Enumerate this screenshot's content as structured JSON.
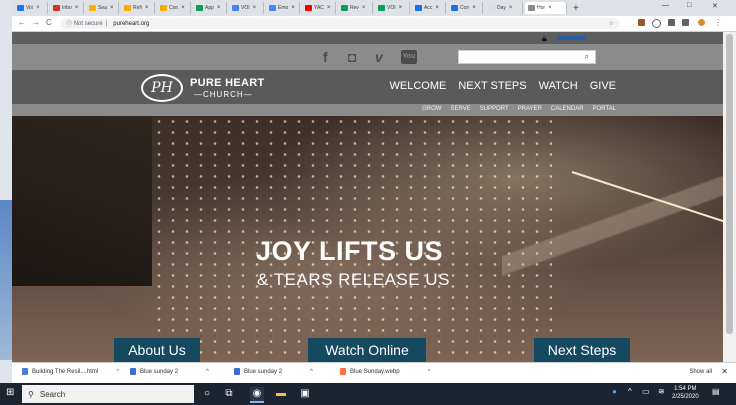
{
  "browser": {
    "tabs": [
      {
        "label": "Voi",
        "color": "#1a73e8"
      },
      {
        "label": "Inbo",
        "color": "#d93025"
      },
      {
        "label": "Sea",
        "color": "#f4b400"
      },
      {
        "label": "Refi",
        "color": "#f9ab00"
      },
      {
        "label": "Con",
        "color": "#f9ab00"
      },
      {
        "label": "App",
        "color": "#0f9d58"
      },
      {
        "label": "VOI",
        "color": "#4285f4"
      },
      {
        "label": "Emo",
        "color": "#4285f4"
      },
      {
        "label": "YAC",
        "color": "#ff0000"
      },
      {
        "label": "Rev",
        "color": "#0f9d58"
      },
      {
        "label": "VOI",
        "color": "#0f9d58"
      },
      {
        "label": "Acc",
        "color": "#1a73e8"
      },
      {
        "label": "Con",
        "color": "#1a73e8"
      },
      {
        "label": "Day",
        "color": "#dadce0"
      },
      {
        "label": "Hor",
        "color": "#888888"
      }
    ],
    "new_tab": "+",
    "win_min": "—",
    "win_max": "□",
    "win_close": "✕",
    "back": "←",
    "forward": "→",
    "reload": "C",
    "security": "Not secure",
    "url": "pureheart.org",
    "star": "☆"
  },
  "site": {
    "social": {
      "facebook": "f",
      "instagram": "◘",
      "vimeo": "v",
      "youtube": "You"
    },
    "search": {
      "glass": "⌕"
    },
    "logo": {
      "mark": "PH",
      "name": "PURE HEART",
      "sub": "CHURCH"
    },
    "main_nav": [
      "WELCOME",
      "NEXT STEPS",
      "WATCH",
      "GIVE"
    ],
    "sub_nav": [
      "GROW",
      "SERVE",
      "SUPPORT",
      "PRAYER",
      "CALENDAR",
      "PORTAL"
    ],
    "hero": {
      "line1": "JOY LIFTS US",
      "line2": "& TEARS RELEASE US"
    },
    "ctas": [
      "About Us",
      "Watch Online",
      "Next Steps"
    ]
  },
  "downloads": {
    "items": [
      {
        "name": "Building The Resil....html",
        "color": "#4a7bd0"
      },
      {
        "name": "Blue sunday 2",
        "color": "#3d6bd8"
      },
      {
        "name": "Blue sunday 2",
        "color": "#3d6bd8"
      },
      {
        "name": "Blue Sunday.webp",
        "color": "#ff7043"
      }
    ],
    "show_all": "Show all",
    "close": "✕"
  },
  "taskbar": {
    "search_placeholder": "Search",
    "time": "1:54 PM",
    "date": "2/25/2020"
  }
}
